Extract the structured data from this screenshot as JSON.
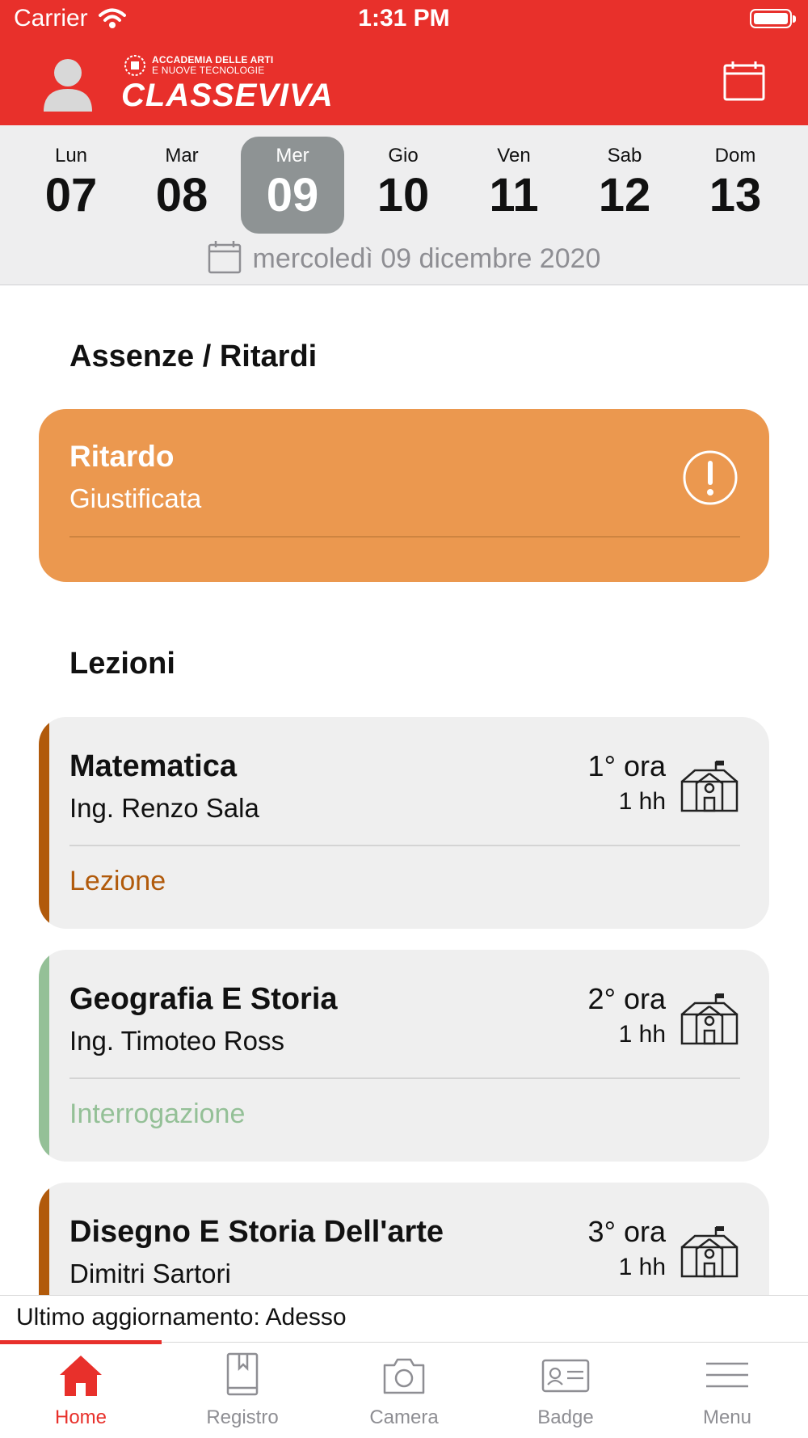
{
  "status_bar": {
    "carrier": "Carrier",
    "time": "1:31 PM"
  },
  "header": {
    "logo_line1": "ACCADEMIA DELLE ARTI",
    "logo_line2": "E NUOVE TECNOLOGIE",
    "logo_name": "CLASSEVIVA",
    "brand_color": "#e8302b"
  },
  "week": {
    "days": [
      {
        "name": "Lun",
        "num": "07"
      },
      {
        "name": "Mar",
        "num": "08"
      },
      {
        "name": "Mer",
        "num": "09"
      },
      {
        "name": "Gio",
        "num": "10"
      },
      {
        "name": "Ven",
        "num": "11"
      },
      {
        "name": "Sab",
        "num": "12"
      },
      {
        "name": "Dom",
        "num": "13"
      }
    ],
    "selected_index": 2,
    "full_date": "mercoledì 09 dicembre 2020"
  },
  "absences": {
    "title": "Assenze / Ritardi",
    "card": {
      "title": "Ritardo",
      "subtitle": "Giustificata",
      "color": "#eb984f"
    }
  },
  "lessons": {
    "title": "Lezioni",
    "items": [
      {
        "subject": "Matematica",
        "teacher": "Ing. Renzo Sala",
        "hour": "1° ora",
        "duration": "1 hh",
        "type": "Lezione",
        "color": "#b15a0b"
      },
      {
        "subject": "Geografia E Storia",
        "teacher": "Ing. Timoteo Ross",
        "hour": "2° ora",
        "duration": "1 hh",
        "type": "Interrogazione",
        "color": "#94c097"
      },
      {
        "subject": "Disegno E Storia Dell'arte",
        "teacher": "Dimitri Sartori",
        "hour": "3° ora",
        "duration": "1 hh",
        "type": "",
        "color": "#b15a0b"
      }
    ]
  },
  "update_bar": {
    "text": "Ultimo aggiornamento: Adesso"
  },
  "tabbar": {
    "tabs": [
      {
        "label": "Home",
        "icon": "home-icon"
      },
      {
        "label": "Registro",
        "icon": "book-icon"
      },
      {
        "label": "Camera",
        "icon": "camera-icon"
      },
      {
        "label": "Badge",
        "icon": "badge-icon"
      },
      {
        "label": "Menu",
        "icon": "menu-icon"
      }
    ],
    "active_index": 0
  }
}
